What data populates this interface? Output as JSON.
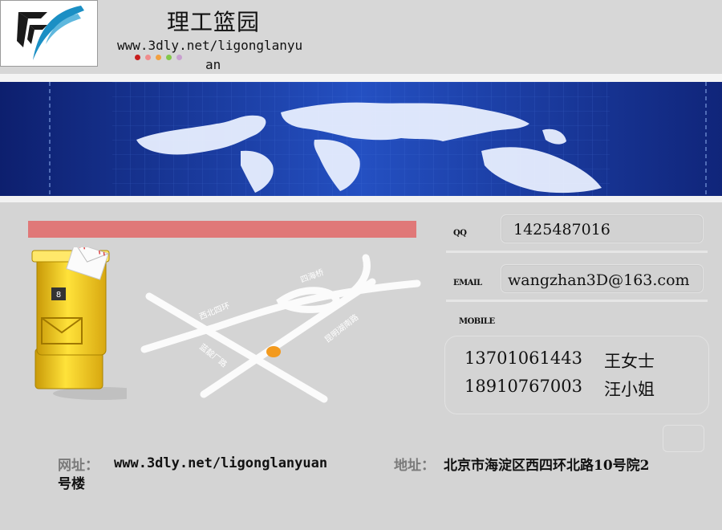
{
  "header": {
    "title": "理工篮园",
    "url_line1": "www.3dly.net/ligonglanyu",
    "url_line2": "an",
    "dot_colors": [
      "#c81e1e",
      "#f08c8c",
      "#f2a040",
      "#84c84a",
      "#c8a0d0"
    ]
  },
  "contact": {
    "qq_label": "QQ",
    "qq_value": "1425487016",
    "email_label": "EMAIL",
    "email_value": "wangzhan3D@163.com",
    "mobile_label": "MOBILE",
    "mobiles": [
      {
        "number": "13701061443",
        "name": "王女士"
      },
      {
        "number": "18910767003",
        "name": "汪小姐"
      }
    ]
  },
  "map": {
    "roads": [
      "四海桥",
      "西北四环",
      "昆明湖南路",
      "蓝靛厂路"
    ]
  },
  "footer": {
    "site_label": "网址：",
    "site_value": "www.3dly.net/ligonglanyuan",
    "address_label": "地址：",
    "address_line1": "北京市海淀区西四环北路10号院2",
    "address_line2": "号楼"
  },
  "colors": {
    "accent_bar": "#e07878",
    "banner_blue": "#1e3ea8",
    "marker": "#f39a1e"
  }
}
